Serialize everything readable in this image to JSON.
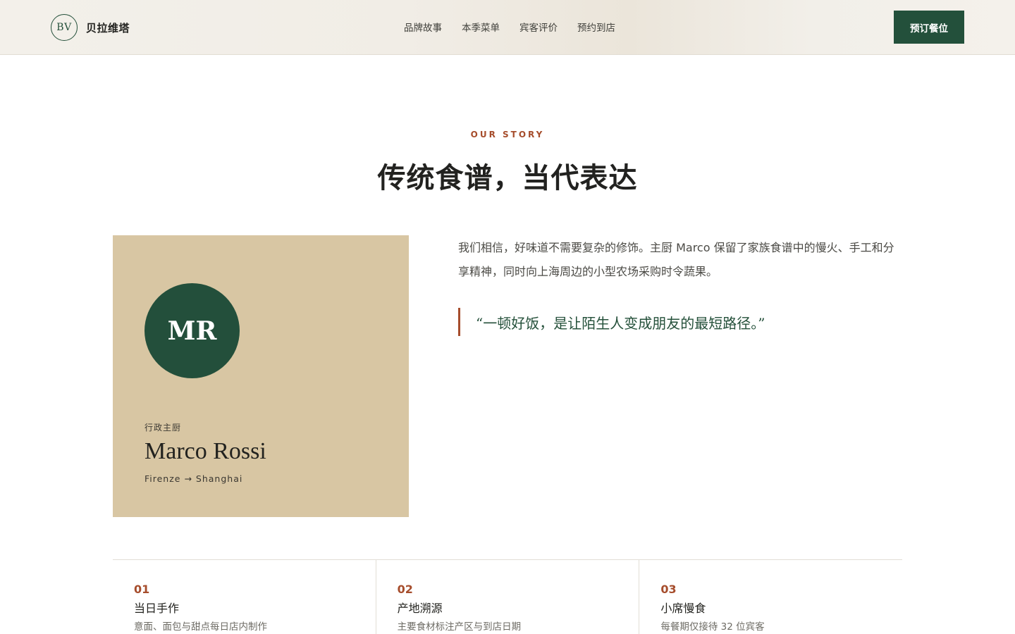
{
  "header": {
    "logo_mark": "BV",
    "brand_name": "贝拉维塔",
    "nav": [
      "品牌故事",
      "本季菜单",
      "宾客评价",
      "预约到店"
    ],
    "reserve_label": "预订餐位"
  },
  "story": {
    "eyebrow": "OUR STORY",
    "title": "传统食谱，当代表达",
    "paragraph": "我们相信，好味道不需要复杂的修饰。主厨 Marco 保留了家族食谱中的慢火、手工和分享精神，同时向上海周边的小型农场采购时令蔬果。",
    "quote": "“一顿好饭，是让陌生人变成朋友的最短路径。”"
  },
  "chef": {
    "initials": "MR",
    "role": "行政主厨",
    "name": "Marco Rossi",
    "route": "Firenze → Shanghai"
  },
  "features": [
    {
      "num": "01",
      "title": "当日手作",
      "desc": "意面、面包与甜点每日店内制作"
    },
    {
      "num": "02",
      "title": "产地溯源",
      "desc": "主要食材标注产区与到店日期"
    },
    {
      "num": "03",
      "title": "小席慢食",
      "desc": "每餐期仅接待 32 位宾客"
    }
  ],
  "colors": {
    "brand_green": "#23503b",
    "accent_rust": "#a64d2c",
    "card_sand": "#d8c6a3"
  }
}
